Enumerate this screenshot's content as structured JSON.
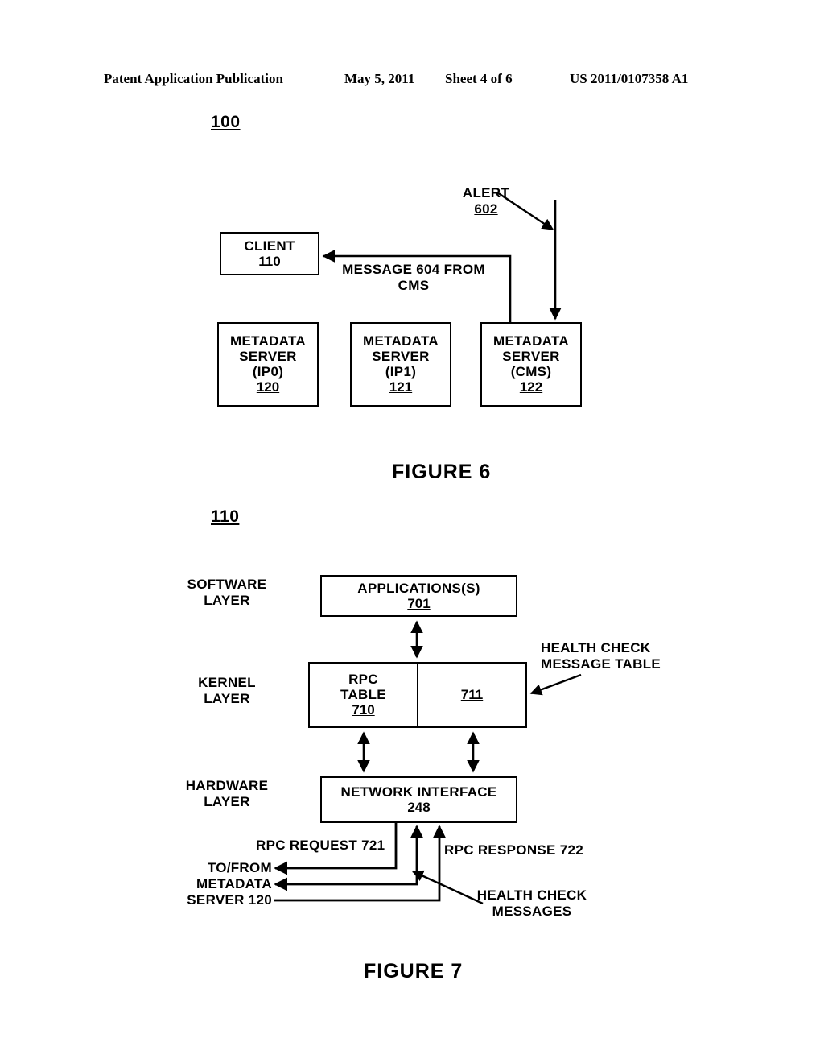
{
  "header": {
    "publication": "Patent Application Publication",
    "date": "May 5, 2011",
    "sheet": "Sheet 4 of 6",
    "patent_number": "US 2011/0107358 A1"
  },
  "figure6": {
    "caption": "FIGURE 6",
    "system_ref": "100",
    "client_box": {
      "title": "CLIENT",
      "ref": "110"
    },
    "alert_label": {
      "text": "ALERT",
      "ref": "602"
    },
    "message_label": {
      "line1_pre": "MESSAGE ",
      "line1_ref": "604",
      "line1_post": " FROM",
      "line2": "CMS"
    },
    "servers": [
      {
        "l1": "METADATA",
        "l2": "SERVER",
        "l3": "(IP0)",
        "ref": "120"
      },
      {
        "l1": "METADATA",
        "l2": "SERVER",
        "l3": "(IP1)",
        "ref": "121"
      },
      {
        "l1": "METADATA",
        "l2": "SERVER",
        "l3": "(CMS)",
        "ref": "122"
      }
    ]
  },
  "figure7": {
    "caption": "FIGURE 7",
    "client_ref": "110",
    "layers": [
      {
        "l1": "SOFTWARE",
        "l2": "LAYER"
      },
      {
        "l1": "KERNEL",
        "l2": "LAYER"
      },
      {
        "l1": "HARDWARE",
        "l2": "LAYER"
      }
    ],
    "applications_box": {
      "title": "APPLICATIONS(S)",
      "ref": "701"
    },
    "rpc_table_box": {
      "l1": "RPC",
      "l2": "TABLE",
      "ref": "710"
    },
    "health_check_table_box": {
      "ref": "711"
    },
    "health_check_table_callout": {
      "l1": "HEALTH CHECK",
      "l2": "MESSAGE TABLE"
    },
    "network_interface_box": {
      "title": "NETWORK INTERFACE",
      "ref": "248"
    },
    "rpc_request_label": "RPC REQUEST 721",
    "rpc_response_label": "RPC RESPONSE 722",
    "to_from_label": {
      "l1": "TO/FROM",
      "l2": "METADATA",
      "l3": "SERVER 120"
    },
    "health_check_messages_callout": {
      "l1": "HEALTH CHECK",
      "l2": "MESSAGES"
    }
  },
  "colors": {
    "ink": "#000000",
    "paper": "#ffffff"
  }
}
